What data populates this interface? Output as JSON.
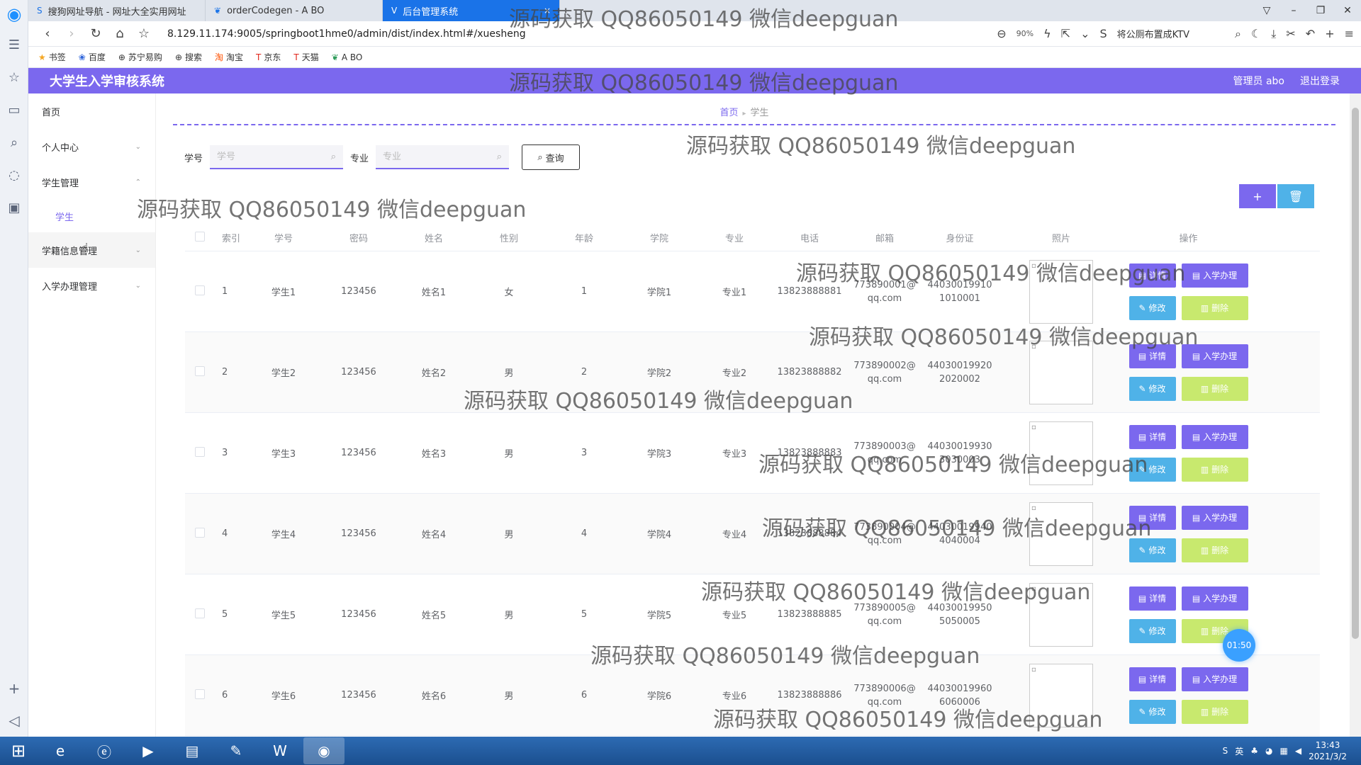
{
  "browser": {
    "tabs": [
      {
        "title": "搜狗网址导航 - 网址大全实用网址",
        "active": false
      },
      {
        "title": "orderCodegen - A BO",
        "active": false
      },
      {
        "title": "后台管理系统",
        "active": true
      }
    ],
    "url": "8.129.11.174:9005/springboot1hme0/admin/dist/index.html#/xuesheng",
    "zoom": "90%",
    "search_hint": "将公厕布置成KTV",
    "bookmarks": [
      "书签",
      "百度",
      "苏宁易购",
      "搜索",
      "淘宝",
      "京东",
      "天猫",
      "A BO"
    ]
  },
  "app": {
    "title": "大学生入学审核系统",
    "user_label": "管理员 abo",
    "logout_label": "退出登录"
  },
  "menu": {
    "home": "首页",
    "personal": "个人中心",
    "student_mgmt": "学生管理",
    "student": "学生",
    "roll_mgmt": "学籍信息管理",
    "admission_mgmt": "入学办理管理"
  },
  "breadcrumb": {
    "home": "首页",
    "current": "学生"
  },
  "search": {
    "xuehao_label": "学号",
    "xuehao_placeholder": "学号",
    "zhuanye_label": "专业",
    "zhuanye_placeholder": "专业",
    "query_label": "查询"
  },
  "table": {
    "headers": [
      "索引",
      "学号",
      "密码",
      "姓名",
      "性别",
      "年龄",
      "学院",
      "专业",
      "电话",
      "邮箱",
      "身份证",
      "照片",
      "操作"
    ],
    "rows": [
      {
        "idx": "1",
        "xh": "学生1",
        "mm": "123456",
        "xm": "姓名1",
        "xb": "女",
        "nl": "1",
        "xy": "学院1",
        "zy": "专业1",
        "dh": "13823888881",
        "yx1": "773890001@",
        "yx2": "qq.com",
        "sfz1": "44030019910",
        "sfz2": "1010001"
      },
      {
        "idx": "2",
        "xh": "学生2",
        "mm": "123456",
        "xm": "姓名2",
        "xb": "男",
        "nl": "2",
        "xy": "学院2",
        "zy": "专业2",
        "dh": "13823888882",
        "yx1": "773890002@",
        "yx2": "qq.com",
        "sfz1": "44030019920",
        "sfz2": "2020002"
      },
      {
        "idx": "3",
        "xh": "学生3",
        "mm": "123456",
        "xm": "姓名3",
        "xb": "男",
        "nl": "3",
        "xy": "学院3",
        "zy": "专业3",
        "dh": "13823888883",
        "yx1": "773890003@",
        "yx2": "qq.com",
        "sfz1": "44030019930",
        "sfz2": "3030003"
      },
      {
        "idx": "4",
        "xh": "学生4",
        "mm": "123456",
        "xm": "姓名4",
        "xb": "男",
        "nl": "4",
        "xy": "学院4",
        "zy": "专业4",
        "dh": "13823888884",
        "yx1": "773890004@",
        "yx2": "qq.com",
        "sfz1": "44030019940",
        "sfz2": "4040004"
      },
      {
        "idx": "5",
        "xh": "学生5",
        "mm": "123456",
        "xm": "姓名5",
        "xb": "男",
        "nl": "5",
        "xy": "学院5",
        "zy": "专业5",
        "dh": "13823888885",
        "yx1": "773890005@",
        "yx2": "qq.com",
        "sfz1": "44030019950",
        "sfz2": "5050005"
      },
      {
        "idx": "6",
        "xh": "学生6",
        "mm": "123456",
        "xm": "姓名6",
        "xb": "男",
        "nl": "6",
        "xy": "学院6",
        "zy": "专业6",
        "dh": "13823888886",
        "yx1": "773890006@",
        "yx2": "qq.com",
        "sfz1": "44030019960",
        "sfz2": "6060006"
      }
    ],
    "ops": {
      "detail": "详情",
      "ruxue": "入学办理",
      "edit": "修改",
      "remove": "删除"
    }
  },
  "timer": "01:50",
  "watermark": "源码获取 QQ86050149 微信deepguan",
  "taskbar": {
    "ime": "英",
    "time": "13:43",
    "date": "2021/3/2"
  },
  "colors": {
    "accent": "#7b68ee",
    "edit": "#4fb2e8",
    "remove": "#c8e96e"
  }
}
